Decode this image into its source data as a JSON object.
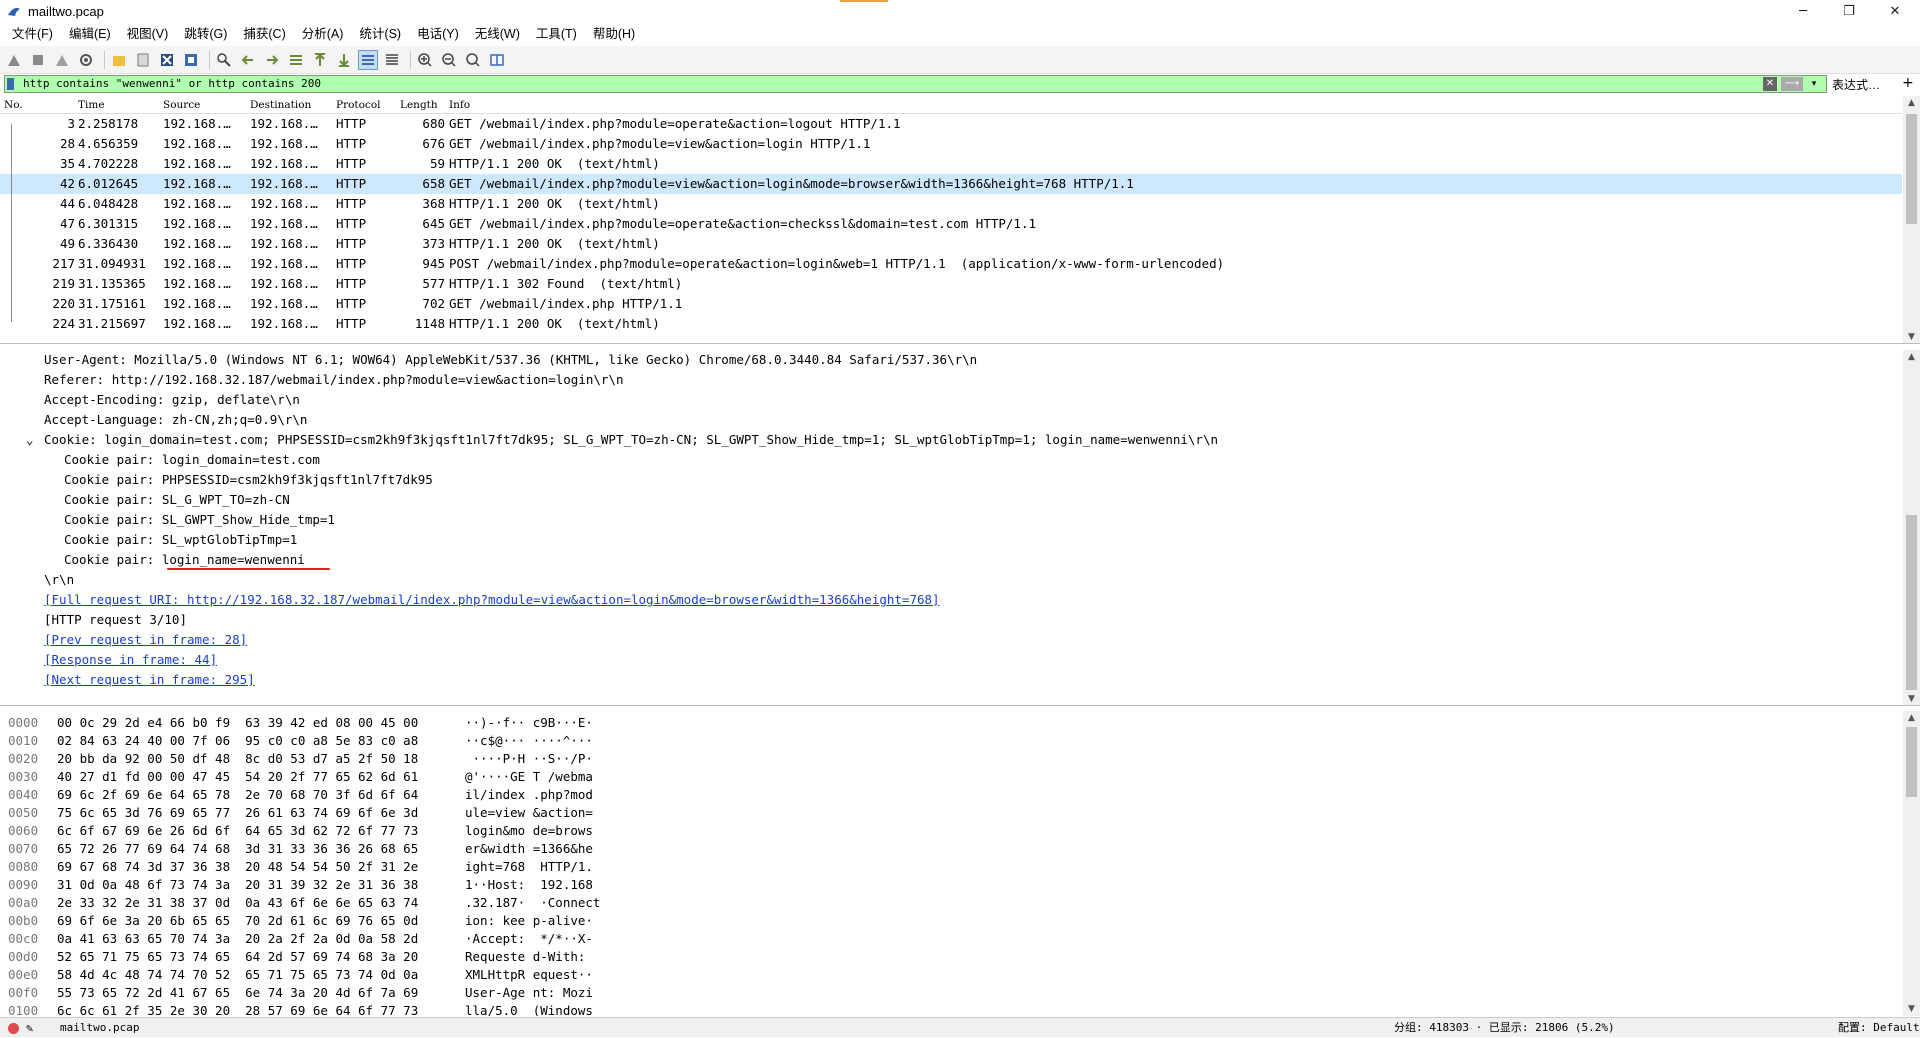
{
  "window": {
    "title": "mailtwo.pcap",
    "controls": {
      "minimize": "─",
      "restore": "❐",
      "close": "✕"
    }
  },
  "menu": [
    "文件(F)",
    "编辑(E)",
    "视图(V)",
    "跳转(G)",
    "捕获(C)",
    "分析(A)",
    "统计(S)",
    "电话(Y)",
    "无线(W)",
    "工具(T)",
    "帮助(H)"
  ],
  "filter": {
    "value": "http contains \"wenwenni\" or http contains 200",
    "clear_label": "✕",
    "apply_label": "⟶",
    "dropdown_label": "▾",
    "expression_label": "表达式…",
    "add_label": "+"
  },
  "packet_list": {
    "columns": {
      "no": "No.",
      "time": "Time",
      "source": "Source",
      "destination": "Destination",
      "protocol": "Protocol",
      "length": "Length",
      "info": "Info"
    },
    "rows": [
      {
        "no": "3",
        "time": "2.258178",
        "source": "192.168.…",
        "destination": "192.168.…",
        "protocol": "HTTP",
        "length": "680",
        "info": "GET /webmail/index.php?module=operate&action=logout HTTP/1.1"
      },
      {
        "no": "28",
        "time": "4.656359",
        "source": "192.168.…",
        "destination": "192.168.…",
        "protocol": "HTTP",
        "length": "676",
        "info": "GET /webmail/index.php?module=view&action=login HTTP/1.1"
      },
      {
        "no": "35",
        "time": "4.702228",
        "source": "192.168.…",
        "destination": "192.168.…",
        "protocol": "HTTP",
        "length": "59",
        "info": "HTTP/1.1 200 OK  (text/html)"
      },
      {
        "no": "42",
        "time": "6.012645",
        "source": "192.168.…",
        "destination": "192.168.…",
        "protocol": "HTTP",
        "length": "658",
        "info": "GET /webmail/index.php?module=view&action=login&mode=browser&width=1366&height=768 HTTP/1.1"
      },
      {
        "no": "44",
        "time": "6.048428",
        "source": "192.168.…",
        "destination": "192.168.…",
        "protocol": "HTTP",
        "length": "368",
        "info": "HTTP/1.1 200 OK  (text/html)"
      },
      {
        "no": "47",
        "time": "6.301315",
        "source": "192.168.…",
        "destination": "192.168.…",
        "protocol": "HTTP",
        "length": "645",
        "info": "GET /webmail/index.php?module=operate&action=checkssl&domain=test.com HTTP/1.1"
      },
      {
        "no": "49",
        "time": "6.336430",
        "source": "192.168.…",
        "destination": "192.168.…",
        "protocol": "HTTP",
        "length": "373",
        "info": "HTTP/1.1 200 OK  (text/html)"
      },
      {
        "no": "217",
        "time": "31.094931",
        "source": "192.168.…",
        "destination": "192.168.…",
        "protocol": "HTTP",
        "length": "945",
        "info": "POST /webmail/index.php?module=operate&action=login&web=1 HTTP/1.1  (application/x-www-form-urlencoded)"
      },
      {
        "no": "219",
        "time": "31.135365",
        "source": "192.168.…",
        "destination": "192.168.…",
        "protocol": "HTTP",
        "length": "577",
        "info": "HTTP/1.1 302 Found  (text/html)"
      },
      {
        "no": "220",
        "time": "31.175161",
        "source": "192.168.…",
        "destination": "192.168.…",
        "protocol": "HTTP",
        "length": "702",
        "info": "GET /webmail/index.php HTTP/1.1"
      },
      {
        "no": "224",
        "time": "31.215697",
        "source": "192.168.…",
        "destination": "192.168.…",
        "protocol": "HTTP",
        "length": "1148",
        "info": "HTTP/1.1 200 OK  (text/html)"
      }
    ],
    "selected_no": "42"
  },
  "details": {
    "lines": [
      "User-Agent: Mozilla/5.0 (Windows NT 6.1; WOW64) AppleWebKit/537.36 (KHTML, like Gecko) Chrome/68.0.3440.84 Safari/537.36\\r\\n",
      "Referer: http://192.168.32.187/webmail/index.php?module=view&action=login\\r\\n",
      "Accept-Encoding: gzip, deflate\\r\\n",
      "Accept-Language: zh-CN,zh;q=0.9\\r\\n",
      "Cookie: login_domain=test.com; PHPSESSID=csm2kh9f3kjqsft1nl7ft7dk95; SL_G_WPT_TO=zh-CN; SL_GWPT_Show_Hide_tmp=1; SL_wptGlobTipTmp=1; login_name=wenwenni\\r\\n"
    ],
    "cookie_pairs": [
      "login_domain=test.com",
      "PHPSESSID=csm2kh9f3kjqsft1nl7ft7dk95",
      "SL_G_WPT_TO=zh-CN",
      "SL_GWPT_Show_Hide_tmp=1",
      "SL_wptGlobTipTmp=1",
      "login_name=wenwenni"
    ],
    "cookie_pair_label": "Cookie pair: ",
    "crlf": "\\r\\n",
    "full_request_uri": "[Full request URI: http://192.168.32.187/webmail/index.php?module=view&action=login&mode=browser&width=1366&height=768]",
    "http_request": "[HTTP request 3/10]",
    "prev_request": "[Prev request in frame: 28]",
    "response_in": "[Response in frame: 44]",
    "next_request": "[Next request in frame: 295]"
  },
  "bytes": {
    "rows": [
      {
        "off": "0000",
        "hex": "00 0c 29 2d e4 66 b0 f9  63 39 42 ed 08 00 45 00",
        "ascii": "··)-·f·· c9B···E·"
      },
      {
        "off": "0010",
        "hex": "02 84 63 24 40 00 7f 06  95 c0 c0 a8 5e 83 c0 a8",
        "ascii": "··c$@··· ····^···"
      },
      {
        "off": "0020",
        "hex": "20 bb da 92 00 50 df 48  8c d0 53 d7 a5 2f 50 18",
        "ascii": " ····P·H ··S··/P·"
      },
      {
        "off": "0030",
        "hex": "40 27 d1 fd 00 00 47 45  54 20 2f 77 65 62 6d 61",
        "ascii": "@'····GE T /webma"
      },
      {
        "off": "0040",
        "hex": "69 6c 2f 69 6e 64 65 78  2e 70 68 70 3f 6d 6f 64",
        "ascii": "il/index .php?mod"
      },
      {
        "off": "0050",
        "hex": "75 6c 65 3d 76 69 65 77  26 61 63 74 69 6f 6e 3d",
        "ascii": "ule=view &action="
      },
      {
        "off": "0060",
        "hex": "6c 6f 67 69 6e 26 6d 6f  64 65 3d 62 72 6f 77 73",
        "ascii": "login&mo de=brows"
      },
      {
        "off": "0070",
        "hex": "65 72 26 77 69 64 74 68  3d 31 33 36 36 26 68 65",
        "ascii": "er&width =1366&he"
      },
      {
        "off": "0080",
        "hex": "69 67 68 74 3d 37 36 38  20 48 54 54 50 2f 31 2e",
        "ascii": "ight=768  HTTP/1."
      },
      {
        "off": "0090",
        "hex": "31 0d 0a 48 6f 73 74 3a  20 31 39 32 2e 31 36 38",
        "ascii": "1··Host:  192.168"
      },
      {
        "off": "00a0",
        "hex": "2e 33 32 2e 31 38 37 0d  0a 43 6f 6e 6e 65 63 74",
        "ascii": ".32.187·  ·Connect"
      },
      {
        "off": "00b0",
        "hex": "69 6f 6e 3a 20 6b 65 65  70 2d 61 6c 69 76 65 0d",
        "ascii": "ion: kee p-alive·"
      },
      {
        "off": "00c0",
        "hex": "0a 41 63 63 65 70 74 3a  20 2a 2f 2a 0d 0a 58 2d",
        "ascii": "·Accept:  */*··X-"
      },
      {
        "off": "00d0",
        "hex": "52 65 71 75 65 73 74 65  64 2d 57 69 74 68 3a 20",
        "ascii": "Requeste d-With: "
      },
      {
        "off": "00e0",
        "hex": "58 4d 4c 48 74 74 70 52  65 71 75 65 73 74 0d 0a",
        "ascii": "XMLHttpR equest··"
      },
      {
        "off": "00f0",
        "hex": "55 73 65 72 2d 41 67 65  6e 74 3a 20 4d 6f 7a 69",
        "ascii": "User-Age nt: Mozi"
      },
      {
        "off": "0100",
        "hex": "6c 6c 61 2f 35 2e 30 20  28 57 69 6e 64 6f 77 73",
        "ascii": "lla/5.0  (Windows"
      }
    ]
  },
  "status": {
    "file": "mailtwo.pcap",
    "packets": "分组: 418303 · 已显示: 21806 (5.2%)",
    "profile": "配置: Default"
  },
  "colors": {
    "filter_bg": "#afffaf",
    "selected_row": "#cde8ff",
    "link": "#1a3fd0",
    "annotation": "#e02020"
  }
}
